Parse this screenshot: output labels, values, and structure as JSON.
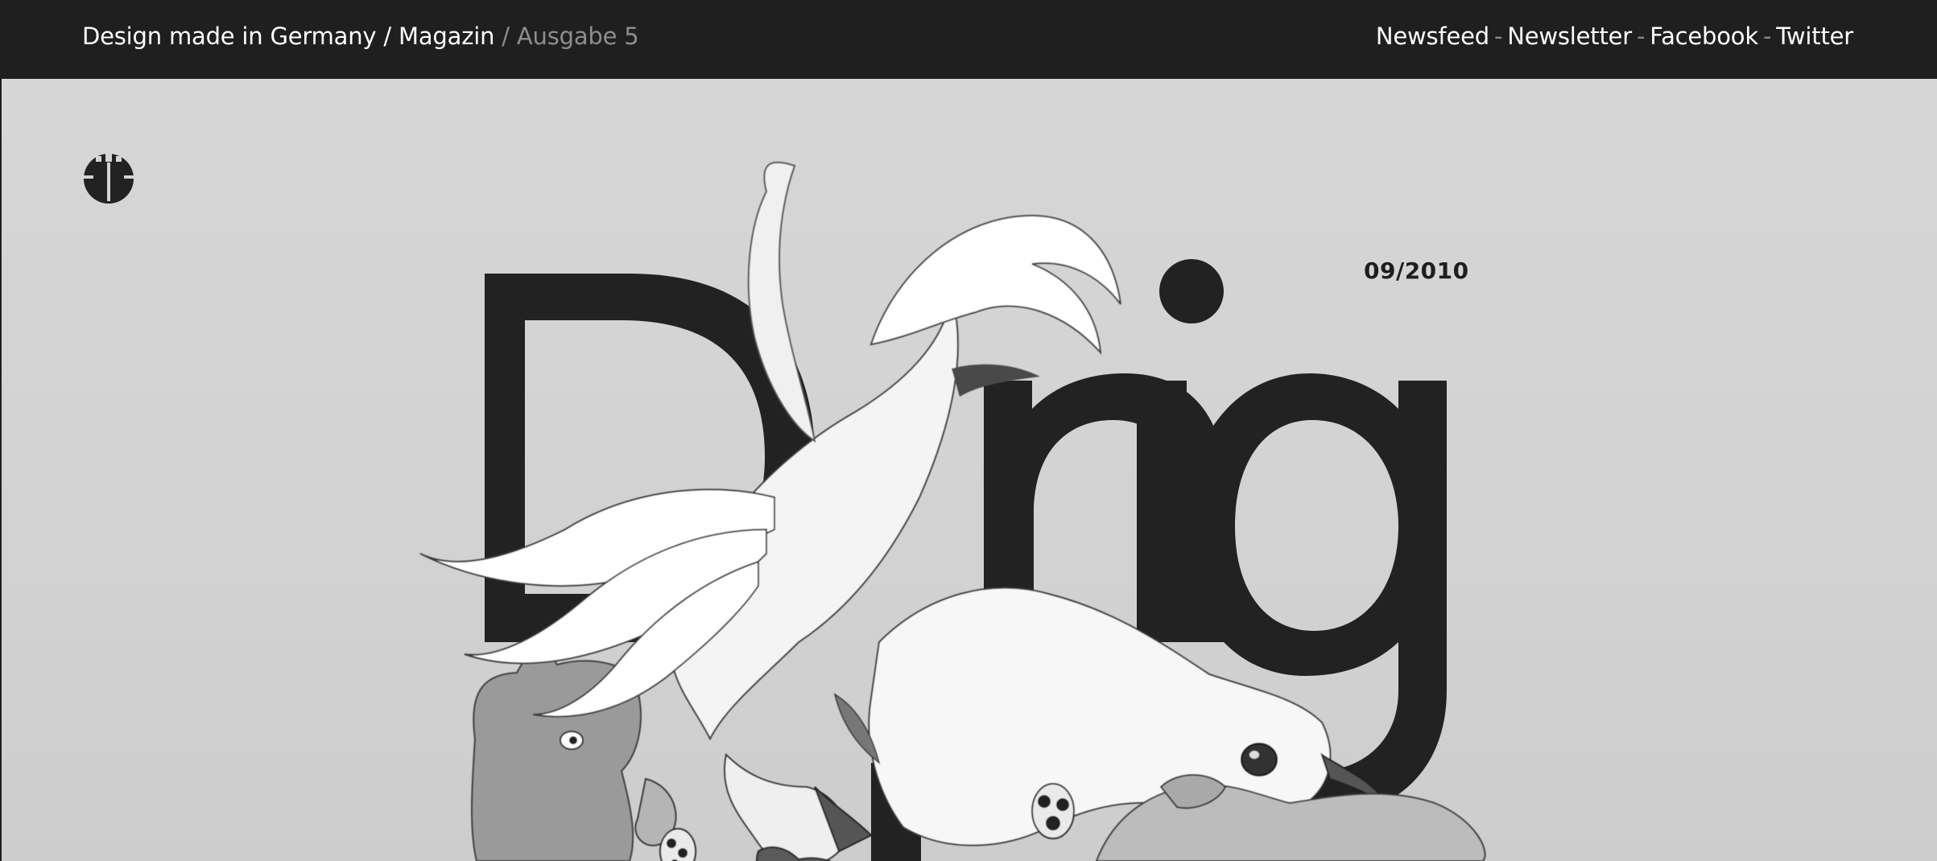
{
  "header": {
    "brand_title": "Design made in Germany",
    "separator": "/",
    "magazine_label": "Magazin",
    "issue_label": "/ Ausgabe 5"
  },
  "nav": {
    "items": [
      {
        "label": "Newsfeed"
      },
      {
        "label": "Newsletter"
      },
      {
        "label": "Facebook"
      },
      {
        "label": "Twitter"
      }
    ],
    "separator": "-"
  },
  "cover": {
    "date": "09/2010",
    "big_letters_top": "Desig",
    "big_letters_bottom": "n"
  },
  "colors": {
    "topbar": "#1f1f1f",
    "background": "#d4d4d4",
    "ink": "#222222",
    "muted_text": "#8d8d8d"
  },
  "icons": {
    "logo": "eagle-emblem-icon"
  }
}
